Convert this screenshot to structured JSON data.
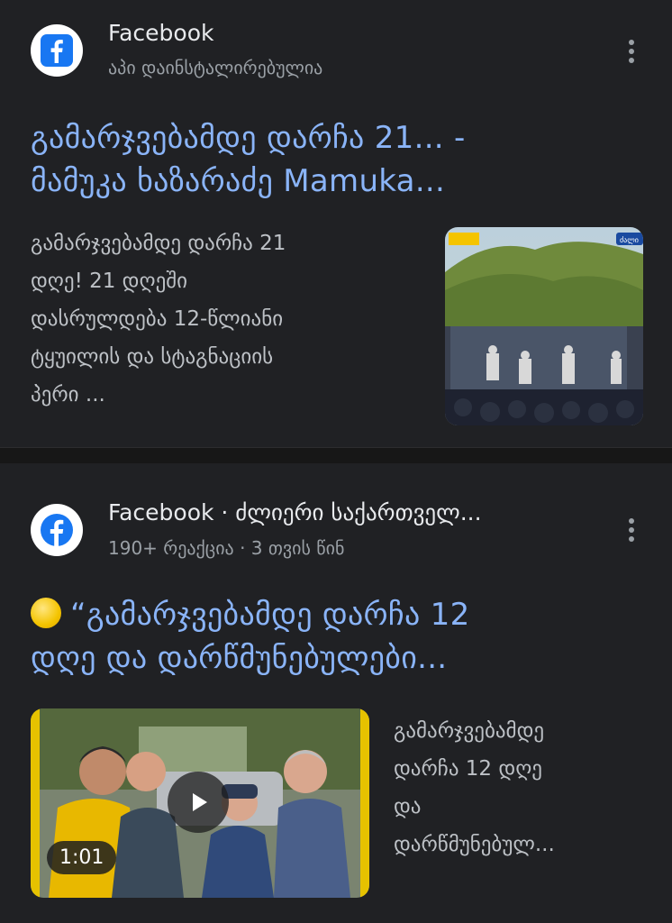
{
  "results": [
    {
      "source_name": "Facebook",
      "source_sub": "აპი დაინსტალირებულია",
      "title_line1": "გამარჯვებამდე დარჩა 21... -",
      "title_line2": "მამუკა ხაზარაძე Mamuka...",
      "snippet_lines": [
        "გამარჯვებამდე დარჩა 21",
        "დღე! 21 დღეში",
        "დასრულდება 12-წლიანი",
        "ტყუილის და სტაგნაციის",
        "პერი ..."
      ],
      "thumb_badge": "ძალი"
    },
    {
      "source_name": "Facebook · ძლიერი საქართველ...",
      "source_sub": "190+ რეაქცია · 3 თვის წინ",
      "emoji": "yellow-circle",
      "title_line1": "“გამარჯვებამდე დარჩა 12",
      "title_line2": "დღე და დარწმუნებულები...",
      "snippet_lines": [
        "გამარჯვებამდე",
        "დარჩა 12 დღე",
        "და",
        "დარწმუნებულ..."
      ],
      "duration": "1:01"
    }
  ],
  "colors": {
    "background": "#202124",
    "title_link": "#8ab4f8",
    "snippet": "#bdc1c6",
    "facebook_blue": "#1877f2"
  }
}
